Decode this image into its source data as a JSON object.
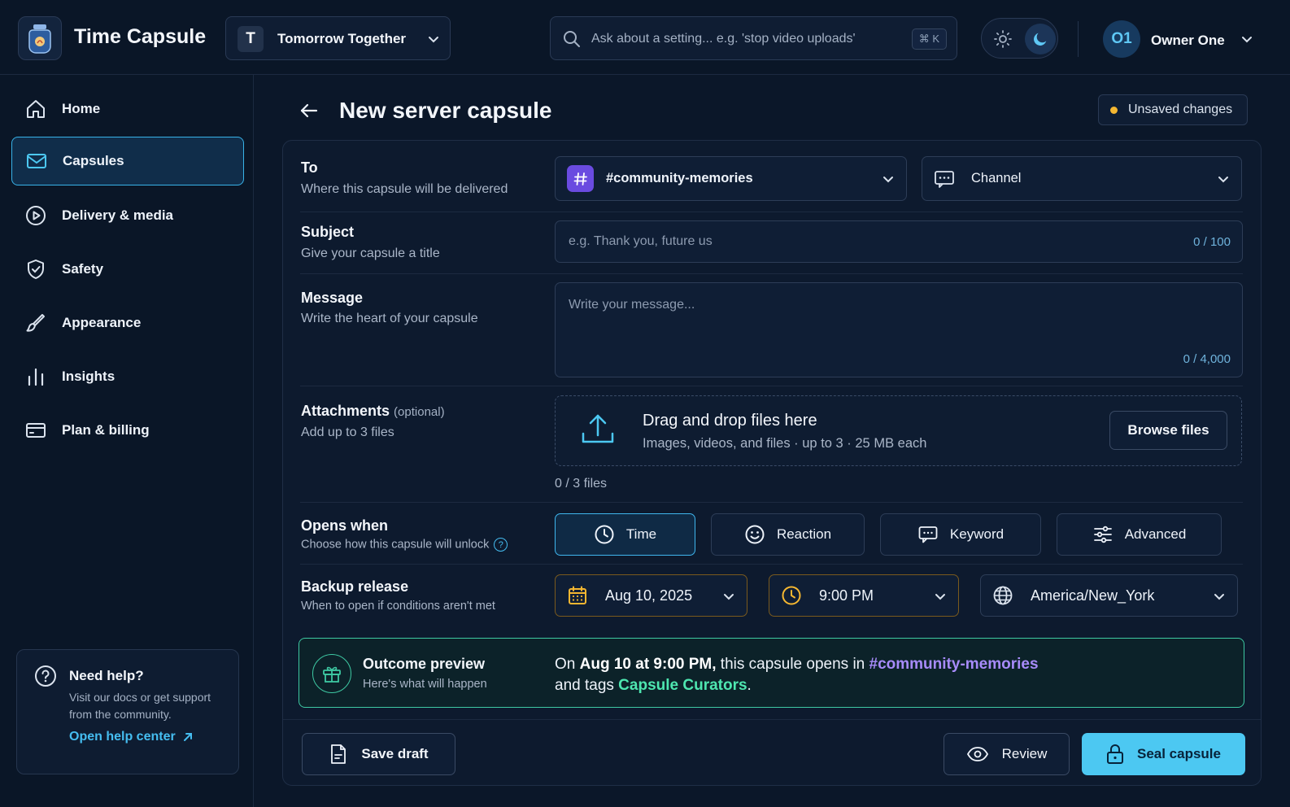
{
  "app": {
    "title": "Time Capsule"
  },
  "workspace": {
    "initial": "T",
    "name": "Tomorrow Together"
  },
  "search": {
    "placeholder": "Ask about a setting... e.g. 'stop video uploads'",
    "shortcut": "⌘ K"
  },
  "user": {
    "initials": "O1",
    "name": "Owner One"
  },
  "sidebar": {
    "items": [
      {
        "label": "Home",
        "icon": "home-icon",
        "active": false
      },
      {
        "label": "Capsules",
        "icon": "mail-icon",
        "active": true
      },
      {
        "label": "Delivery & media",
        "icon": "play-circle-icon",
        "active": false
      },
      {
        "label": "Safety",
        "icon": "shield-check-icon",
        "active": false
      },
      {
        "label": "Appearance",
        "icon": "brush-icon",
        "active": false
      },
      {
        "label": "Insights",
        "icon": "bar-chart-icon",
        "active": false
      },
      {
        "label": "Plan & billing",
        "icon": "credit-card-icon",
        "active": false
      }
    ],
    "help": {
      "title": "Need help?",
      "body": "Visit our docs or get support from the community.",
      "link": "Open help center"
    }
  },
  "page": {
    "title": "New server capsule",
    "status": "Unsaved changes"
  },
  "form": {
    "to": {
      "label": "To",
      "hint": "Where this capsule will be delivered",
      "channel": "#community-memories",
      "type": "Channel"
    },
    "subject": {
      "label": "Subject",
      "hint": "Give your capsule a title",
      "placeholder": "e.g. Thank you, future us",
      "counter": "0 / 100"
    },
    "message": {
      "label": "Message",
      "hint": "Write the heart of your capsule",
      "placeholder": "Write your message...",
      "counter": "0 / 4,000"
    },
    "attachments": {
      "label": "Attachments",
      "optional": "(optional)",
      "hint": "Add up to 3 files",
      "drop_title": "Drag and drop files here",
      "drop_sub": "Images, videos, and files · up to 3 · 25 MB each",
      "browse": "Browse files",
      "count": "0 / 3 files"
    },
    "opens_when": {
      "label": "Opens when",
      "hint": "Choose how this capsule will unlock",
      "help_glyph": "?",
      "options": [
        {
          "label": "Time",
          "icon": "clock-icon",
          "selected": true
        },
        {
          "label": "Reaction",
          "icon": "smile-icon",
          "selected": false
        },
        {
          "label": "Keyword",
          "icon": "chat-icon",
          "selected": false
        },
        {
          "label": "Advanced",
          "icon": "sliders-icon",
          "selected": false
        }
      ]
    },
    "backup": {
      "label": "Backup release",
      "hint": "When to open if conditions aren't met",
      "date": "Aug 10, 2025",
      "time": "9:00 PM",
      "timezone": "America/New_York"
    }
  },
  "preview": {
    "title": "Outcome preview",
    "subtitle": "Here's what will happen",
    "part1": "On ",
    "when": "Aug 10 at 9:00 PM,",
    "part2": " this capsule opens in ",
    "channel": "#community-memories",
    "part3": "and tags ",
    "role": "Capsule Curators",
    "part4": "."
  },
  "actions": {
    "save_draft": "Save draft",
    "review": "Review",
    "seal": "Seal capsule"
  },
  "colors": {
    "accent": "#4cc8f2",
    "success": "#3ec9a3",
    "channel": "#a78bfa",
    "warning": "#f5b731",
    "background": "#0b1729"
  }
}
